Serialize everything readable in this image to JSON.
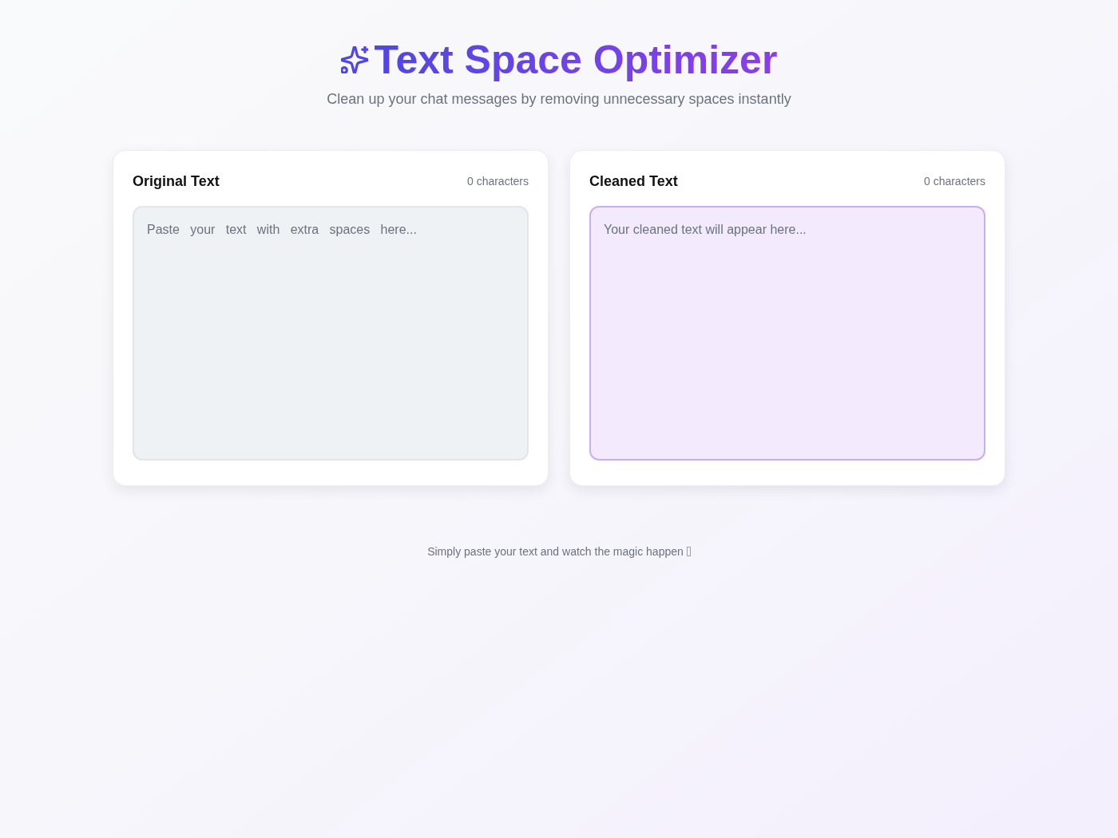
{
  "header": {
    "title": "Text Space Optimizer",
    "subtitle": "Clean up your chat messages by removing unnecessary spaces instantly"
  },
  "panels": [
    {
      "kind": "input",
      "title": "Original Text",
      "count": "0 characters",
      "placeholder": "Paste   your   text   with   extra   spaces   here..."
    },
    {
      "kind": "output",
      "title": "Cleaned Text",
      "count": "0 characters",
      "placeholder": "Your cleaned text will appear here..."
    }
  ],
  "footer": {
    "text": "Simply paste your text and watch the magic happen"
  }
}
